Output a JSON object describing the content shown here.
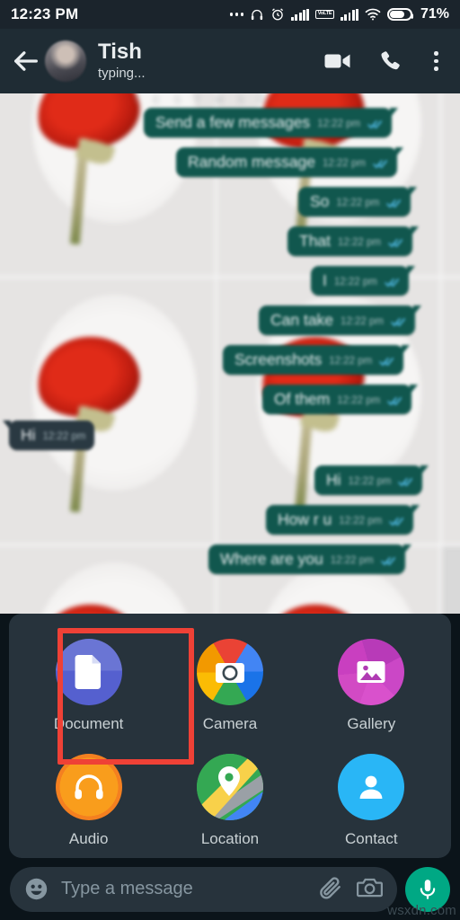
{
  "status_bar": {
    "time": "12:23 PM",
    "battery_percent": "71%",
    "icons": [
      "more-dots-icon",
      "headphones-icon",
      "alarm-clock-icon",
      "signal-bars-icon",
      "volte-icon",
      "signal-bars-2-icon",
      "wifi-icon",
      "battery-icon"
    ],
    "volte_top": "Vo",
    "volte_bottom": "LTE"
  },
  "header": {
    "back_icon": "back-arrow-icon",
    "contact_name": "Tish",
    "contact_status": "typing...",
    "video_call_icon": "video-call-icon",
    "voice_call_icon": "phone-call-icon",
    "overflow_icon": "overflow-menu-icon"
  },
  "chat": {
    "datestamp_fragments": [
      "T",
      "E",
      "S",
      "T",
      "M",
      "S",
      "G"
    ],
    "messages": [
      {
        "text": "Send a few messages",
        "time": "12:22 pm",
        "direction": "out",
        "status": "read"
      },
      {
        "text": "Random message",
        "time": "12:22 pm",
        "direction": "out",
        "status": "read"
      },
      {
        "text": "So",
        "time": "12:22 pm",
        "direction": "out",
        "status": "read"
      },
      {
        "text": "That",
        "time": "12:22 pm",
        "direction": "out",
        "status": "read"
      },
      {
        "text": "I",
        "time": "12:22 pm",
        "direction": "out",
        "status": "read"
      },
      {
        "text": "Can take",
        "time": "12:22 pm",
        "direction": "out",
        "status": "read"
      },
      {
        "text": "Screenshots",
        "time": "12:22 pm",
        "direction": "out",
        "status": "read"
      },
      {
        "text": "Of them",
        "time": "12:22 pm",
        "direction": "out",
        "status": "read"
      },
      {
        "text": "Hi",
        "time": "12:22 pm",
        "direction": "in",
        "status": "none"
      },
      {
        "text": "Hi",
        "time": "12:22 pm",
        "direction": "out",
        "status": "read"
      },
      {
        "text": "How r u",
        "time": "12:22 pm",
        "direction": "out",
        "status": "read"
      },
      {
        "text": "Where are you",
        "time": "12:22 pm",
        "direction": "out",
        "status": "read"
      }
    ]
  },
  "attach_panel": {
    "highlighted": "Document",
    "highlight_color": "#ef4136",
    "items": [
      {
        "label": "Document",
        "icon": "document-icon",
        "color": "#5560cf"
      },
      {
        "label": "Camera",
        "icon": "camera-icon",
        "color": "#e34133"
      },
      {
        "label": "Gallery",
        "icon": "gallery-icon",
        "color": "#c93fc0"
      },
      {
        "label": "Audio",
        "icon": "audio-icon",
        "color": "#f99d1c"
      },
      {
        "label": "Location",
        "icon": "location-icon",
        "color": "#34a853"
      },
      {
        "label": "Contact",
        "icon": "contact-icon",
        "color": "#29b6f6"
      }
    ]
  },
  "input_bar": {
    "emoji_icon": "emoji-icon",
    "placeholder": "Type a message",
    "value": "",
    "attach_icon": "paperclip-icon",
    "camera_icon": "camera-icon",
    "mic_icon": "microphone-icon",
    "accent_color": "#00a884"
  },
  "watermark": "wsxdn.com"
}
